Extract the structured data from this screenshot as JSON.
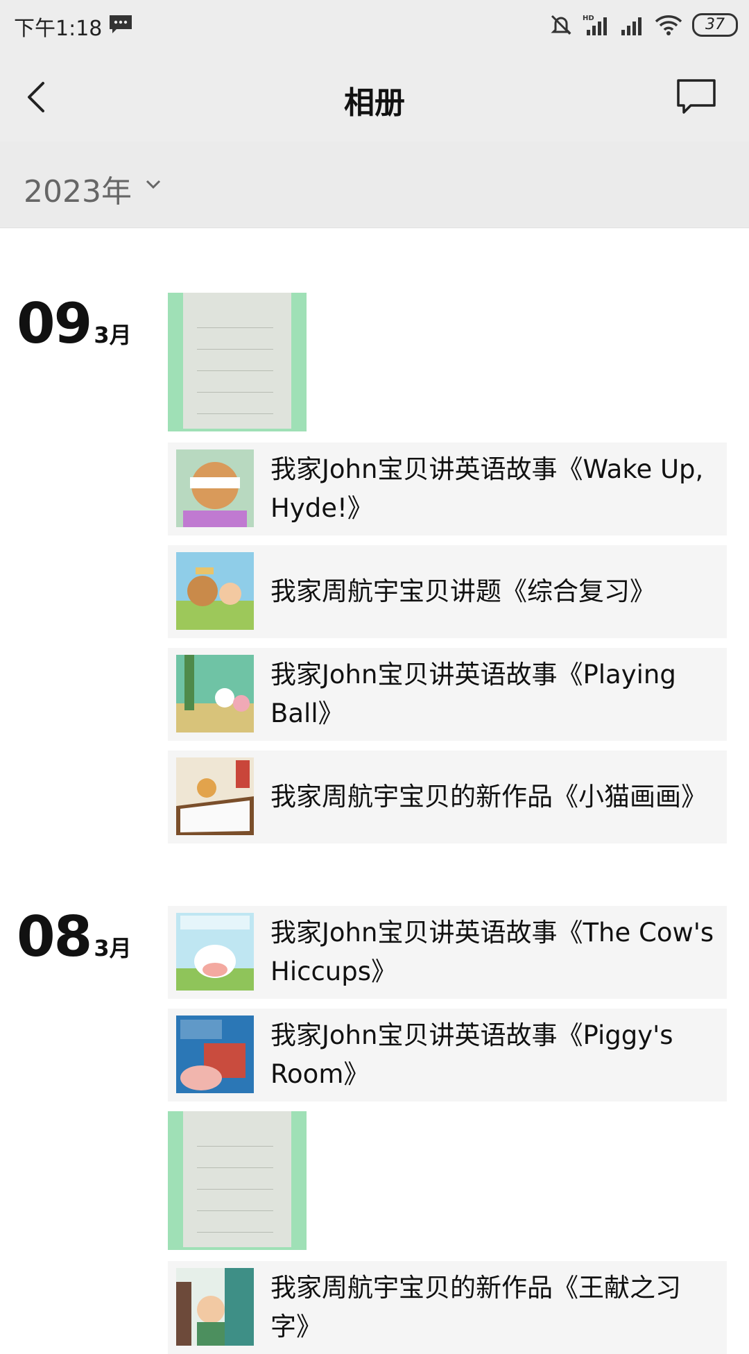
{
  "status_bar": {
    "time": "下午1:18",
    "battery": "37"
  },
  "nav": {
    "title": "相册"
  },
  "filter": {
    "year": "2023年"
  },
  "groups": [
    {
      "day": "09",
      "month": "3月",
      "items": [
        {
          "type": "photo"
        },
        {
          "type": "story",
          "title": "我家John宝贝讲英语故事《Wake Up, Hyde!》"
        },
        {
          "type": "story",
          "title": "我家周航宇宝贝讲题《综合复习》"
        },
        {
          "type": "story",
          "title": "我家John宝贝讲英语故事《Playing Ball》"
        },
        {
          "type": "story",
          "title": "我家周航宇宝贝的新作品《小猫画画》"
        }
      ]
    },
    {
      "day": "08",
      "month": "3月",
      "items": [
        {
          "type": "story",
          "title": "我家John宝贝讲英语故事《The Cow's Hiccups》"
        },
        {
          "type": "story",
          "title": "我家John宝贝讲英语故事《Piggy's Room》"
        },
        {
          "type": "photo"
        },
        {
          "type": "story",
          "title": "我家周航宇宝贝的新作品《王献之习字》"
        }
      ]
    }
  ],
  "colors": {
    "bar_bg": "#ededed",
    "card_bg": "#f5f5f5",
    "photo_bg": "#9fe0b6"
  }
}
